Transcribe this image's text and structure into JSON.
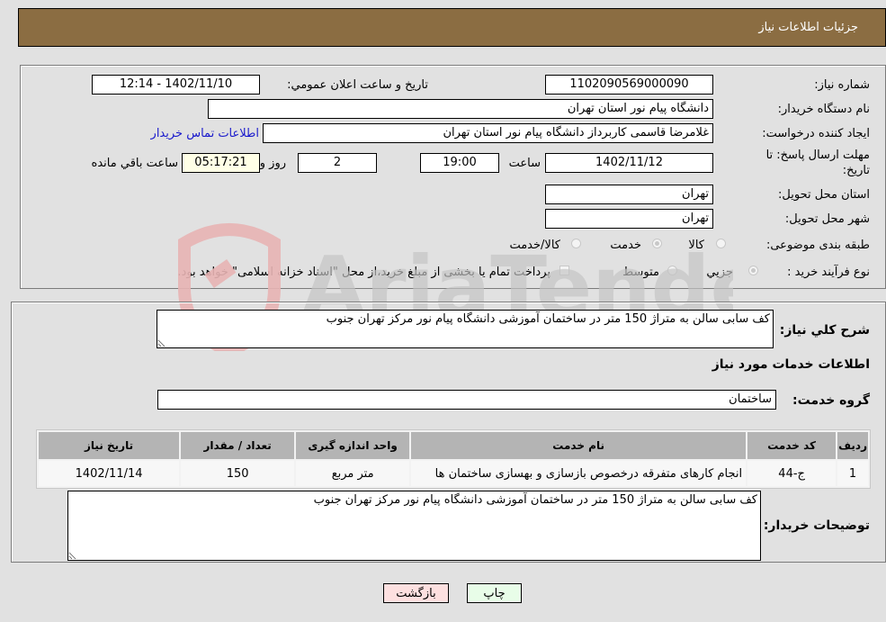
{
  "header": {
    "title": "جزئیات اطلاعات نیاز"
  },
  "fields": {
    "need_number_label": "شماره نیاز:",
    "need_number": "1102090569000090",
    "announce_label": "تاریخ و ساعت اعلان عمومي:",
    "announce_value": "1402/11/10 - 12:14",
    "buyer_org_label": "نام دستگاه خريدار:",
    "buyer_org": "دانشگاه پیام نور استان تهران",
    "creator_label": "ايجاد کننده درخواست:",
    "creator": "غلامرضا قاسمی کاربرداز دانشگاه پیام نور استان تهران",
    "buyer_contact_link": "اطلاعات تماس خريدار",
    "deadline_label_line1": "مهلت ارسال پاسخ: تا",
    "deadline_label_line2": "تاريخ:",
    "deadline_date": "1402/11/12",
    "time_label": "ساعت",
    "deadline_time": "19:00",
    "days_value": "2",
    "days_label": "روز و",
    "remaining_time": "05:17:21",
    "remaining_label": "ساعت باقي مانده",
    "province_label": "استان محل تحويل:",
    "province": "تهران",
    "city_label": "شهر محل تحويل:",
    "city": "تهران",
    "category_label": "طبقه بندی موضوعی:",
    "category_options": [
      "کالا",
      "خدمت",
      "کالا/خدمت"
    ],
    "category_selected": "خدمت",
    "process_label": "نوع فرآيند خريد :",
    "process_options": [
      "جزيي",
      "متوسط"
    ],
    "process_selected": "جزيي",
    "treasury_note": "پرداخت تمام يا بخشی از مبلغ خريد،از محل \"اسناد خزانه اسلامی\" خواهد بود."
  },
  "description": {
    "label": "شرح کلي نياز:",
    "value": "کف سابی سالن به متراژ 150 متر در ساختمان آموزشی دانشگاه پیام نور مرکز تهران جنوب"
  },
  "services": {
    "section_title": "اطلاعات خدمات مورد نياز",
    "group_label": "گروه خدمت:",
    "group_value": "ساختمان",
    "table": {
      "headers": [
        "رديف",
        "کد خدمت",
        "نام خدمت",
        "واحد اندازه گيری",
        "تعداد / مقدار",
        "تاريخ نياز"
      ],
      "rows": [
        {
          "row": "1",
          "code": "ج-44",
          "name": "انجام کارهای متفرقه درخصوص بازسازی و بهسازی ساختمان ها",
          "unit": "متر مربع",
          "qty": "150",
          "date": "1402/11/14"
        }
      ]
    }
  },
  "buyer_notes": {
    "label": "توضيحات خريدار:",
    "value": "کف سابی سالن به متراژ 150 متر در ساختمان آموزشی دانشگاه پیام نور مرکز تهران جنوب"
  },
  "buttons": {
    "print": "چاپ",
    "back": "بازگشت"
  },
  "watermark": {
    "text": "AriaTender.neT"
  }
}
